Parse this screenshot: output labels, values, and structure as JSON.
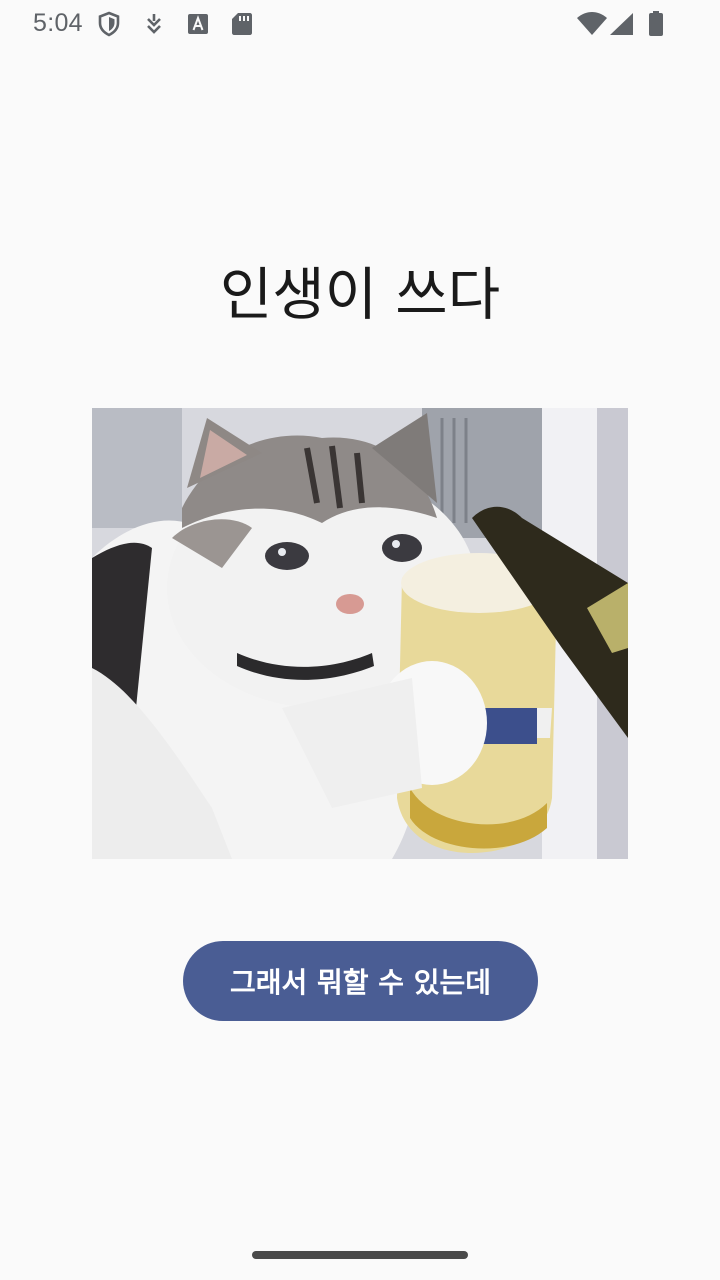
{
  "status_bar": {
    "time": "5:04",
    "left_icons": [
      "shield-icon",
      "download-icon",
      "font-a-icon",
      "sd-card-icon"
    ],
    "right_icons": [
      "wifi-icon",
      "signal-icon",
      "battery-icon"
    ]
  },
  "page": {
    "title": "인생이 쓰다",
    "image": {
      "description_icon": "cat-with-beer-image"
    },
    "button": {
      "label": "그래서 뭐할 수 있는데"
    }
  },
  "colors": {
    "background": "#fafafa",
    "button": "#4a5d94",
    "button_text": "#ffffff",
    "title_text": "#1a1a1a",
    "status_icons": "#5f6368"
  }
}
